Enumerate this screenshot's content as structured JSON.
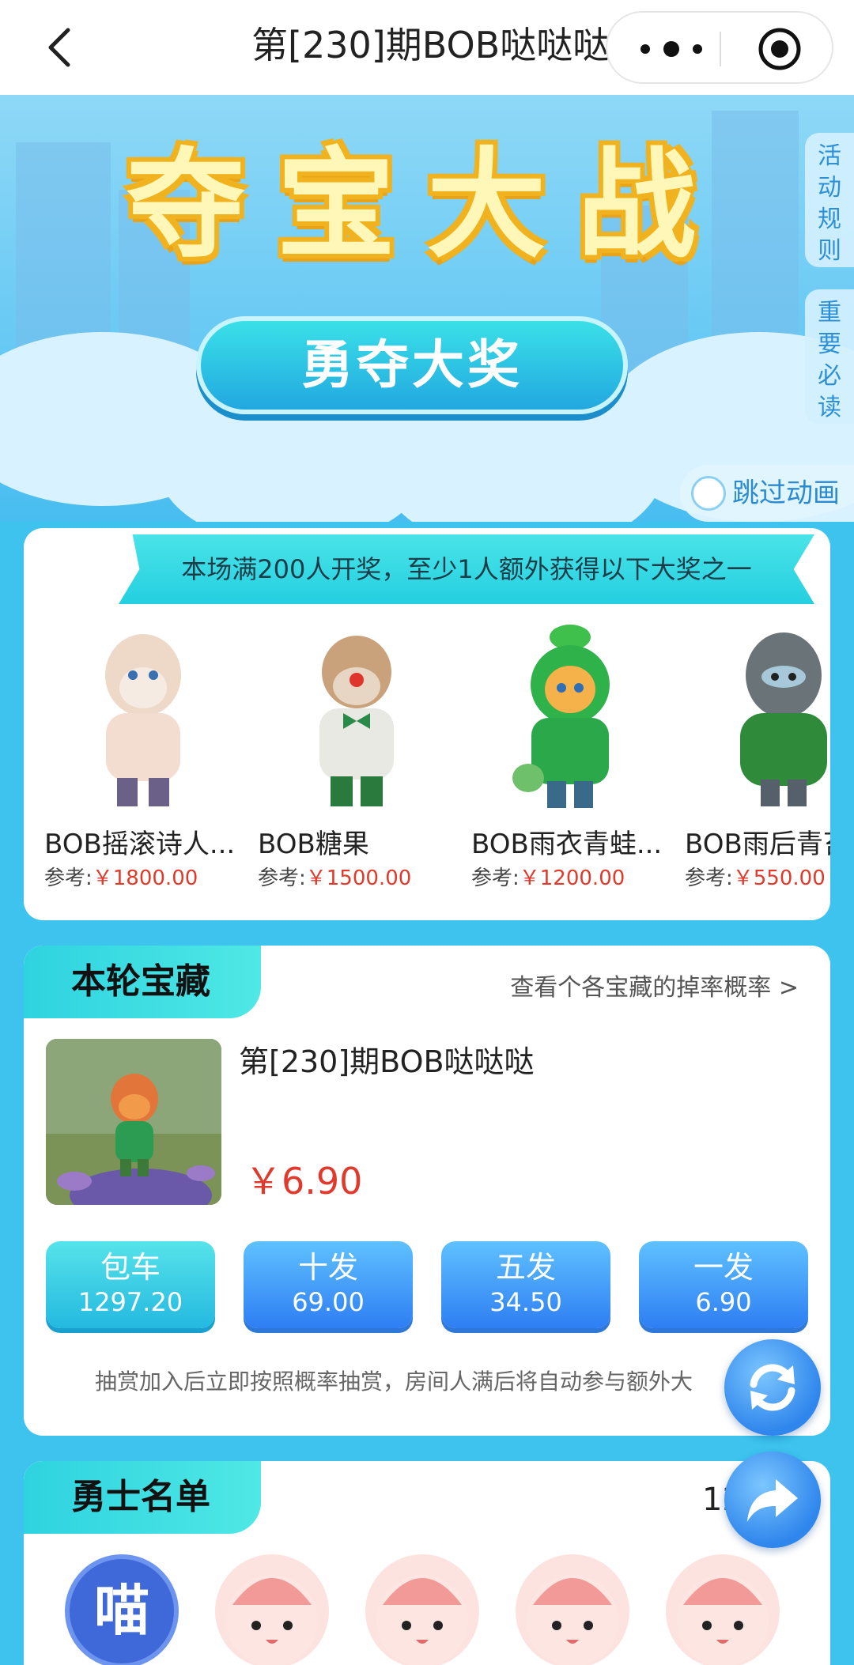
{
  "nav": {
    "title": "第[230]期BOB哒哒哒"
  },
  "hero": {
    "title": "夺宝大战",
    "pill": "勇夺大奖",
    "side_tabs": [
      "活动规则",
      "重要必读"
    ],
    "skip": "跳过动画"
  },
  "prize_section": {
    "banner": "本场满200人开奖，至少1人额外获得以下大奖之一",
    "ref_label": "参考:",
    "items": [
      {
        "name": "BOB摇滚诗人...",
        "price": "￥1800.00"
      },
      {
        "name": "BOB糖果",
        "price": "￥1500.00"
      },
      {
        "name": "BOB雨衣青蛙...",
        "price": "￥1200.00"
      },
      {
        "name": "BOB雨后青苔",
        "price": "￥550.00"
      }
    ]
  },
  "treasure": {
    "tab": "本轮宝藏",
    "drop_link": "查看个各宝藏的掉率概率 >",
    "goods_name": "第[230]期BOB哒哒哒",
    "goods_price": "￥6.90",
    "buttons": [
      {
        "label": "包车",
        "price": "1297.20"
      },
      {
        "label": "十发",
        "price": "69.00"
      },
      {
        "label": "五发",
        "price": "34.50"
      },
      {
        "label": "一发",
        "price": "6.90"
      }
    ],
    "notice": "抽赏加入后立即按照概率抽赏，房间人满后将自动参与额外大"
  },
  "heroes": {
    "tab": "勇士名单",
    "count": "12",
    "first_avatar_text": "喵"
  },
  "colors": {
    "accent_cyan": "#2ed3e0",
    "price_red": "#e03a2c",
    "page_bg": "#3dc3ee"
  },
  "icons": [
    "back-icon",
    "more-icon",
    "target-icon",
    "refresh-icon",
    "share-icon"
  ]
}
